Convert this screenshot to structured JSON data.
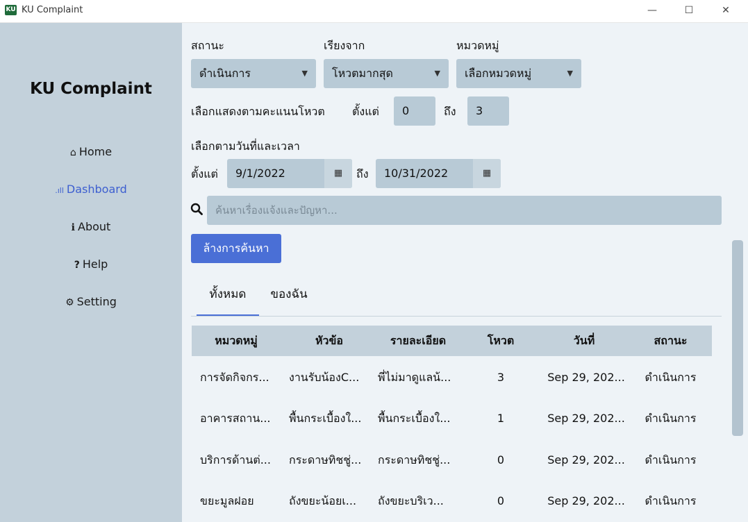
{
  "window": {
    "title": "KU Complaint",
    "icon_text": "KU",
    "minimize": "—",
    "maximize": "☐",
    "close": "✕"
  },
  "sidebar": {
    "brand": "KU Complaint",
    "items": [
      {
        "label": "Home",
        "icon": "⌂",
        "icon_name": "home-icon"
      },
      {
        "label": "Dashboard",
        "icon": ".ıll",
        "icon_name": "signal-bars-icon"
      },
      {
        "label": "About",
        "icon": "ℹ",
        "icon_name": "info-circle-icon"
      },
      {
        "label": "Help",
        "icon": "?",
        "icon_name": "question-icon"
      },
      {
        "label": "Setting",
        "icon": "⚙",
        "icon_name": "gear-icon"
      }
    ],
    "active": "Dashboard",
    "active_color": "#3d5fd0"
  },
  "filters": {
    "status_label": "สถานะ",
    "status_value": "ดำเนินการ",
    "sort_label": "เรียงจาก",
    "sort_value": "โหวตมากสุด",
    "category_label": "หมวดหมู่",
    "category_value": "เลือกหมวดหมู่",
    "vote_label": "เลือกแสดงตามคะแนนโหวต",
    "vote_from_label": "ตั้งแต่",
    "vote_from": "0",
    "vote_to_label": "ถึง",
    "vote_to": "3",
    "date_label": "เลือกตามวันที่และเวลา",
    "date_from_label": "ตั้งแต่",
    "date_from": "9/1/2022",
    "date_to_label": "ถึง",
    "date_to": "10/31/2022"
  },
  "search": {
    "placeholder": "ค้นหาเรื่องแจ้งและปัญหา...",
    "clear_label": "ล้างการค้นหา"
  },
  "tabs": [
    {
      "label": "ทั้งหมด",
      "active": true
    },
    {
      "label": "ของฉัน",
      "active": false
    }
  ],
  "table": {
    "headers": [
      "หมวดหมู่",
      "หัวข้อ",
      "รายละเอียด",
      "โหวต",
      "วันที่",
      "สถานะ"
    ],
    "rows": [
      [
        "การจัดกิจกร...",
        "งานรับน้องC...",
        "พี่ไม่มาดูแลน้...",
        "3",
        "Sep 29, 202...",
        "ดำเนินการ"
      ],
      [
        "อาคารสถาน...",
        "พื้นกระเบื้องใ...",
        "พื้นกระเบื้องใ...",
        "1",
        "Sep 29, 202...",
        "ดำเนินการ"
      ],
      [
        "บริการด้านต่...",
        "กระดาษทิชชู่...",
        "กระดาษทิชชู่...",
        "0",
        "Sep 29, 202...",
        "ดำเนินการ"
      ],
      [
        "ขยะมูลฝอย",
        "ถังขยะน้อยเ...",
        "ถังขยะบริเว...",
        "0",
        "Sep 29, 202...",
        "ดำเนินการ"
      ]
    ]
  },
  "colors": {
    "sidebar_bg": "#c3d1db",
    "main_bg": "#eef3f7",
    "field_bg": "#b8cad6",
    "accent": "#4a6fd6"
  }
}
